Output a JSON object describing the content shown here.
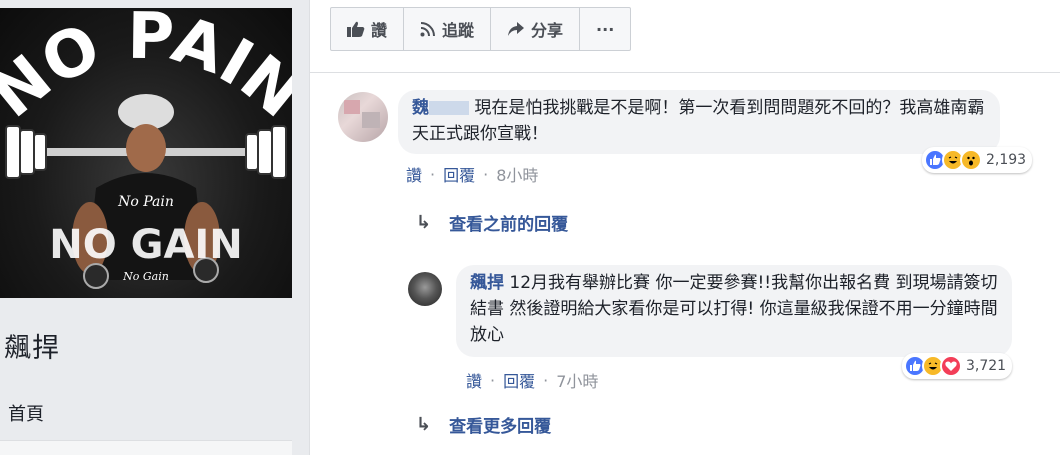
{
  "sidebar": {
    "cover": {
      "arc_text": "NO PAIN",
      "shirt_text": "No Pain",
      "banner_text": "NO GAIN",
      "small_text": "No Gain"
    },
    "page_name": "飆捍",
    "nav": {
      "home": "首頁"
    }
  },
  "action_bar": {
    "like": "讚",
    "follow": "追蹤",
    "share": "分享",
    "more": "···"
  },
  "comments": [
    {
      "author": "魏",
      "text": " 現在是怕我挑戰是不是啊！第一次看到問問題死不回的？我高雄南霸天正式跟你宣戰！",
      "like": "讚",
      "reply": "回覆",
      "time": "8小時",
      "reaction_count": "2,193"
    },
    {
      "author": "飆捍",
      "text": " 12月我有舉辦比賽 你一定要參賽!!我幫你出報名費 到現場請簽切結書 然後證明給大家看你是可以打得! 你這量級我保證不用一分鐘時間放心",
      "like": "讚",
      "reply": "回覆",
      "time": "7小時",
      "reaction_count": "3,721"
    }
  ],
  "links": {
    "previous_replies": "查看之前的回覆",
    "more_replies": "查看更多回覆"
  },
  "colors": {
    "link": "#365899",
    "like_blue": "#4a76ff",
    "haha_yellow": "#f7b928",
    "love_red": "#f33e58"
  },
  "icons": [
    "thumbs-up-icon",
    "rss-icon",
    "share-arrow-icon",
    "reply-arrow-icon",
    "like-reaction-icon",
    "haha-reaction-icon",
    "wow-reaction-icon",
    "love-reaction-icon"
  ]
}
